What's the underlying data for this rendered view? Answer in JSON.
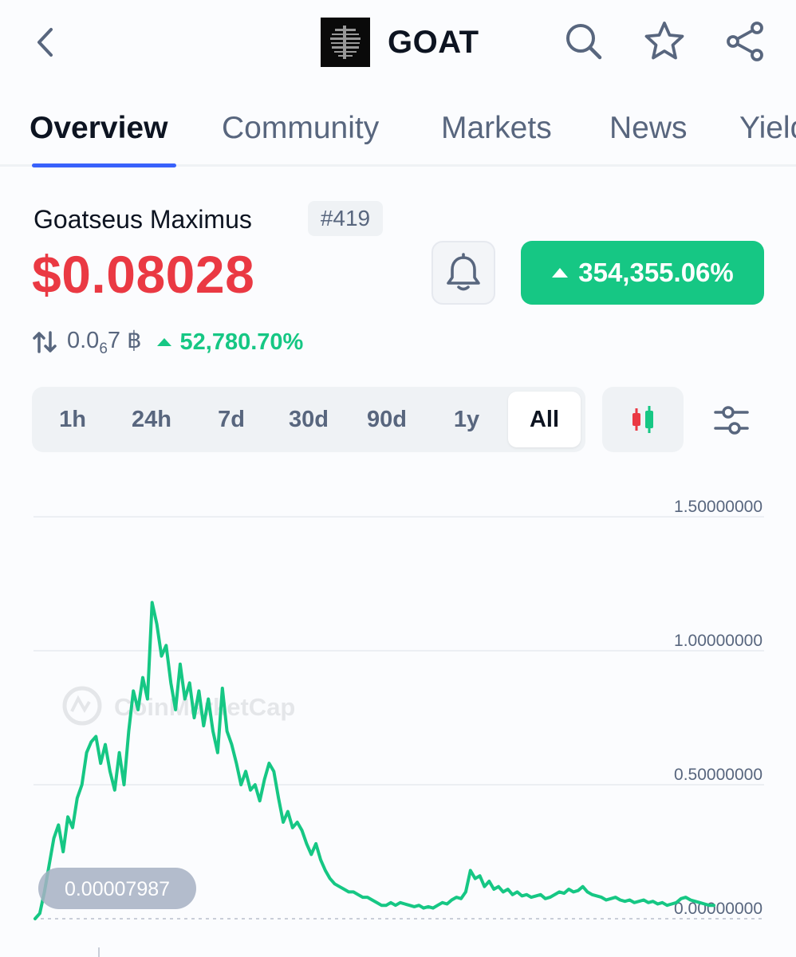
{
  "header": {
    "title": "GOAT",
    "back_icon": "chevron-left-icon",
    "search_icon": "search-icon",
    "star_icon": "star-icon",
    "share_icon": "share-icon"
  },
  "tabs": [
    {
      "label": "Overview",
      "active": true
    },
    {
      "label": "Community",
      "active": false
    },
    {
      "label": "Markets",
      "active": false
    },
    {
      "label": "News",
      "active": false
    },
    {
      "label": "Yield",
      "active": false
    }
  ],
  "coin": {
    "name": "Goatseus Maximus",
    "rank": "#419",
    "price": "$0.08028",
    "change_all": "354,355.06%",
    "btc_price_prefix": "0.0",
    "btc_price_sub": "6",
    "btc_price_suffix": "7 ฿",
    "btc_change": "52,780.70%"
  },
  "ranges": [
    "1h",
    "24h",
    "7d",
    "30d",
    "90d",
    "1y",
    "All"
  ],
  "active_range": "All",
  "colors": {
    "price_red": "#ea3943",
    "positive_green": "#16c784",
    "accent_blue": "#3861fb",
    "muted_text": "#58667e"
  },
  "chart_data": {
    "type": "line",
    "ylim": [
      0,
      1.5
    ],
    "y_ticks": [
      "1.50000000",
      "1.00000000",
      "0.50000000",
      "0.00000000"
    ],
    "start_label": "0.00007987",
    "watermark": "CoinMarketCap",
    "series": [
      {
        "values": [
          0.0,
          0.02,
          0.1,
          0.2,
          0.3,
          0.35,
          0.25,
          0.38,
          0.34,
          0.45,
          0.5,
          0.62,
          0.66,
          0.68,
          0.58,
          0.65,
          0.55,
          0.48,
          0.62,
          0.5,
          0.7,
          0.85,
          0.78,
          0.9,
          0.82,
          1.18,
          1.1,
          0.98,
          1.02,
          0.88,
          0.78,
          0.95,
          0.82,
          0.88,
          0.75,
          0.85,
          0.72,
          0.82,
          0.7,
          0.62,
          0.86,
          0.7,
          0.65,
          0.58,
          0.5,
          0.55,
          0.48,
          0.5,
          0.44,
          0.52,
          0.58,
          0.55,
          0.45,
          0.36,
          0.4,
          0.34,
          0.36,
          0.33,
          0.28,
          0.24,
          0.28,
          0.22,
          0.18,
          0.15,
          0.13,
          0.12,
          0.11,
          0.1,
          0.1,
          0.09,
          0.08,
          0.08,
          0.07,
          0.06,
          0.05,
          0.05,
          0.06,
          0.05,
          0.06,
          0.055,
          0.05,
          0.045,
          0.05,
          0.04,
          0.045,
          0.04,
          0.05,
          0.06,
          0.055,
          0.07,
          0.08,
          0.075,
          0.1,
          0.18,
          0.15,
          0.16,
          0.12,
          0.14,
          0.11,
          0.12,
          0.1,
          0.11,
          0.09,
          0.1,
          0.085,
          0.09,
          0.08,
          0.085,
          0.09,
          0.075,
          0.08,
          0.09,
          0.1,
          0.095,
          0.11,
          0.1,
          0.105,
          0.12,
          0.1,
          0.09,
          0.085,
          0.08,
          0.07,
          0.075,
          0.08,
          0.07,
          0.065,
          0.07,
          0.06,
          0.065,
          0.07,
          0.06,
          0.065,
          0.055,
          0.06,
          0.05,
          0.055,
          0.06,
          0.075,
          0.08,
          0.07,
          0.065,
          0.06,
          0.055,
          0.05,
          0.05
        ]
      }
    ]
  }
}
